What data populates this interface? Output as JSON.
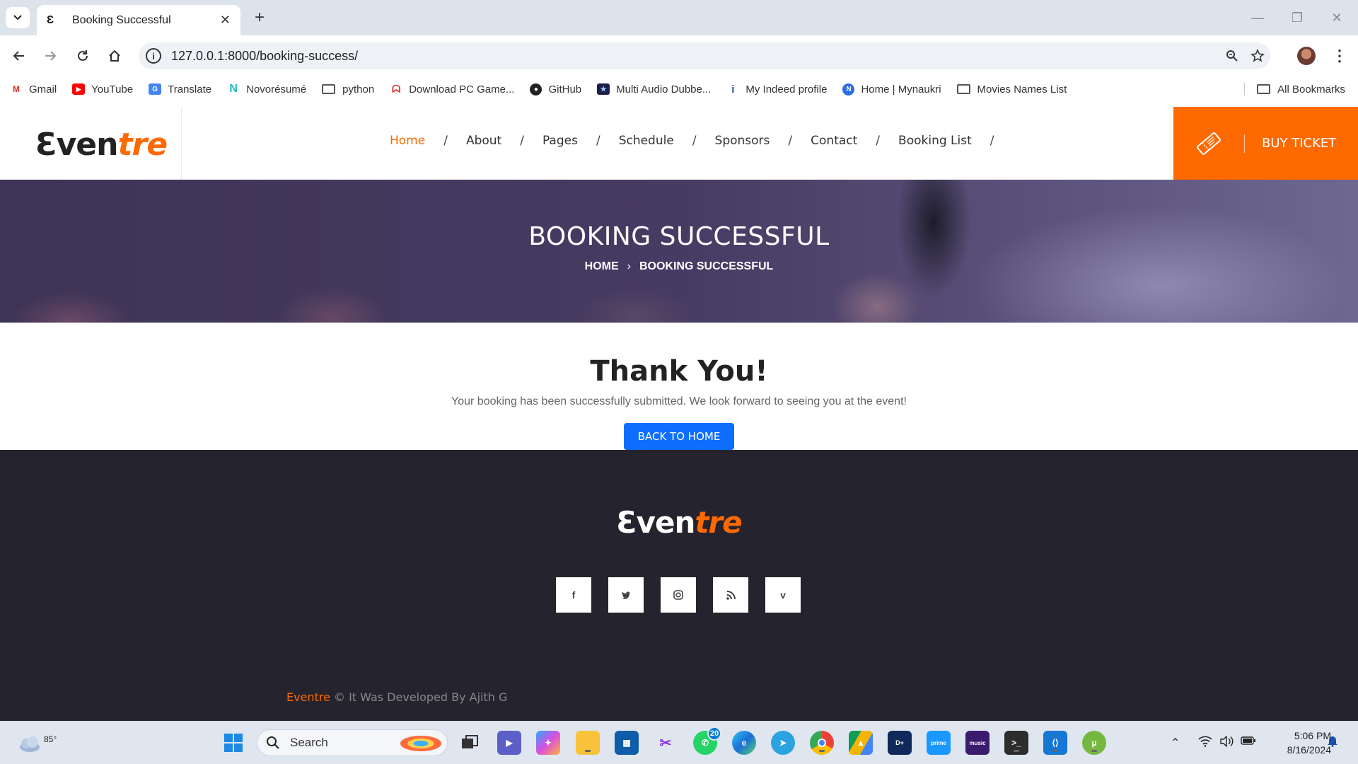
{
  "browser": {
    "tab_title": "Booking Successful",
    "tab_favicon": "Ɛ",
    "url": "127.0.0.1:8000/booking-success/",
    "bookmarks": [
      {
        "label": "Gmail",
        "icon": "gmail-icon"
      },
      {
        "label": "YouTube",
        "icon": "youtube-icon"
      },
      {
        "label": "Translate",
        "icon": "translate-icon"
      },
      {
        "label": "Novorésumé",
        "icon": "novoresume-icon"
      },
      {
        "label": "python",
        "icon": "folder-icon"
      },
      {
        "label": "Download PC Game...",
        "icon": "game-icon"
      },
      {
        "label": "GitHub",
        "icon": "github-icon"
      },
      {
        "label": "Multi Audio Dubbe...",
        "icon": "movie-icon"
      },
      {
        "label": "My Indeed profile",
        "icon": "indeed-icon"
      },
      {
        "label": "Home | Mynaukri",
        "icon": "naukri-icon"
      },
      {
        "label": "Movies Names List",
        "icon": "folder-icon"
      }
    ],
    "all_bookmarks": "All Bookmarks"
  },
  "site": {
    "logo_part1": "Ɛven",
    "logo_part2": "tre",
    "nav": [
      {
        "label": "Home",
        "active": true
      },
      {
        "label": "About"
      },
      {
        "label": "Pages"
      },
      {
        "label": "Schedule"
      },
      {
        "label": "Sponsors"
      },
      {
        "label": "Contact"
      },
      {
        "label": "Booking List"
      }
    ],
    "nav_separator": "/",
    "buy_ticket": "BUY TICKET",
    "accent_color": "#ff6a00"
  },
  "banner": {
    "title": "BOOKING SUCCESSFUL",
    "breadcrumb_home": "HOME",
    "breadcrumb_sep": "›",
    "breadcrumb_current": "BOOKING SUCCESSFUL"
  },
  "content": {
    "heading": "Thank You!",
    "message": "Your booking has been successfully submitted. We look forward to seeing you at the event!",
    "back_button": "BACK TO HOME",
    "button_color": "#0d6efd"
  },
  "footer": {
    "logo_part1": "Ɛven",
    "logo_part2": "tre",
    "socials": [
      {
        "name": "facebook-icon",
        "glyph": "f"
      },
      {
        "name": "twitter-icon",
        "glyph": "🐦"
      },
      {
        "name": "instagram-icon",
        "glyph": "◎"
      },
      {
        "name": "rss-icon",
        "glyph": "◥"
      },
      {
        "name": "vimeo-icon",
        "glyph": "v"
      }
    ],
    "copyright_brand": "Eventre",
    "copyright_text": " © It Was Developed By Ajith G",
    "background": "#25232e"
  },
  "taskbar": {
    "temperature": "85°",
    "search_label": "Search",
    "whatsapp_badge": "20",
    "time": "5:06 PM",
    "date": "8/16/2024"
  }
}
